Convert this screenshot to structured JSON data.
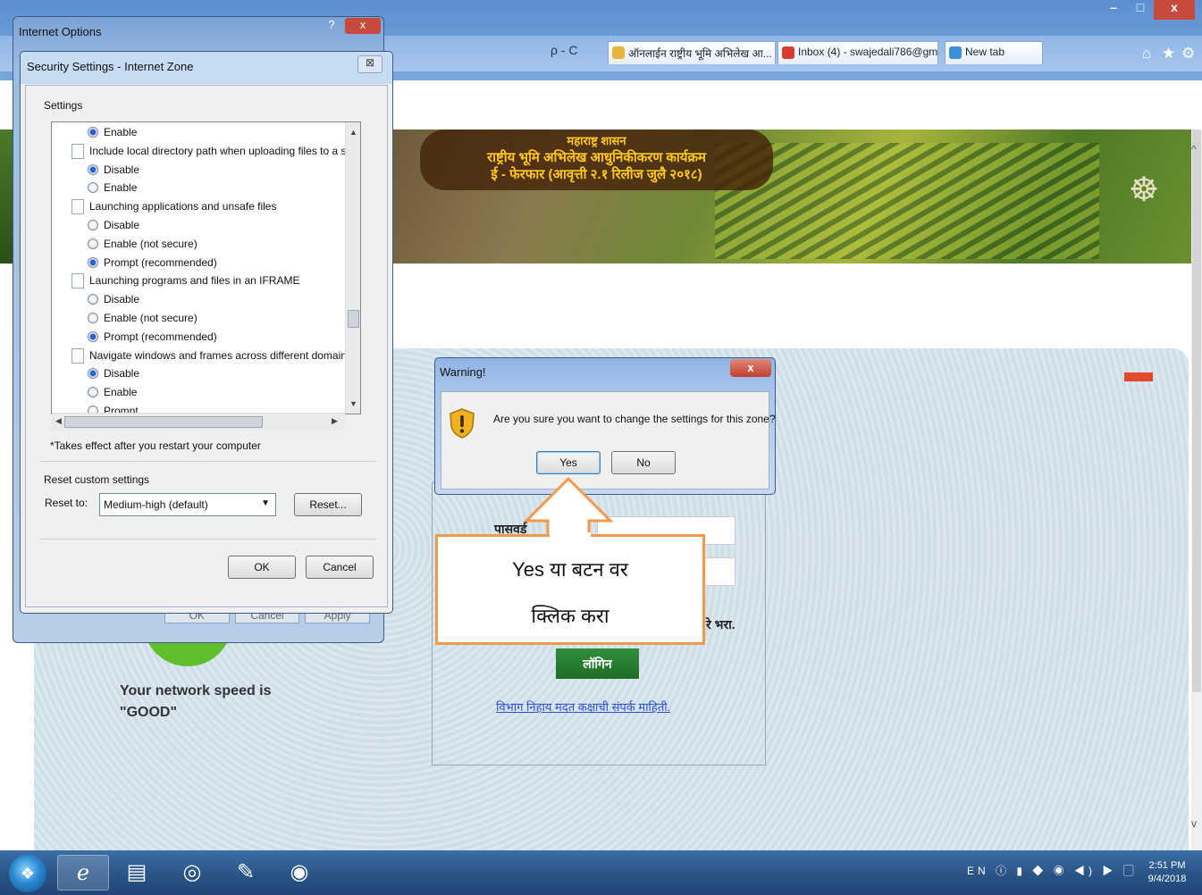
{
  "browser": {
    "tabs": [
      {
        "label": "ऑनलाईन राष्ट्रीय भूमि अभिलेख आ... ×",
        "color": "#e8b53c"
      },
      {
        "label": "Inbox (4) - swajedali786@gm...",
        "color": "#d93b30"
      },
      {
        "label": "New tab",
        "color": "#3a8fd8"
      }
    ],
    "address_tools": "ρ - C",
    "toolbar_icons": [
      "home-icon",
      "star-icon",
      "gear-icon"
    ],
    "window_controls": [
      "–",
      "□",
      "x"
    ]
  },
  "banner": {
    "line1": "महाराष्ट्र शासन",
    "line2": "राष्ट्रीय भूमि अभिलेख आधुनिकीकरण कार्यक्रम",
    "line3": "ई - फेरफार (आवृत्ती २.१ रिलीज जुलै २०१८)",
    "emblem": "seal-emblem"
  },
  "page": {
    "password_label": "पासवर्ड",
    "tail_text": "रे भरा.",
    "login_button": "लॉगिन",
    "help_link": "विभाग निहाय मदत कक्षाची संपर्क माहिती.",
    "network_speed_line1": "Your network speed is",
    "network_speed_line2": "\"GOOD\""
  },
  "internet_options": {
    "title": "Internet Options",
    "help": "?",
    "close": "x",
    "buttons": [
      "OK",
      "Cancel",
      "Apply"
    ]
  },
  "security_settings": {
    "title": "Security Settings - Internet Zone",
    "close": "⊠",
    "settings_label": "Settings",
    "items": [
      {
        "type": "opt",
        "label": "Enable",
        "checked": true
      },
      {
        "type": "hdr",
        "label": "Include local directory path when uploading files to a server"
      },
      {
        "type": "opt",
        "label": "Disable",
        "checked": true
      },
      {
        "type": "opt",
        "label": "Enable",
        "checked": false
      },
      {
        "type": "hdr",
        "label": "Launching applications and unsafe files"
      },
      {
        "type": "opt",
        "label": "Disable",
        "checked": false
      },
      {
        "type": "opt",
        "label": "Enable (not secure)",
        "checked": false
      },
      {
        "type": "opt",
        "label": "Prompt (recommended)",
        "checked": true
      },
      {
        "type": "hdr",
        "label": "Launching programs and files in an IFRAME"
      },
      {
        "type": "opt",
        "label": "Disable",
        "checked": false
      },
      {
        "type": "opt",
        "label": "Enable (not secure)",
        "checked": false
      },
      {
        "type": "opt",
        "label": "Prompt (recommended)",
        "checked": true
      },
      {
        "type": "hdr",
        "label": "Navigate windows and frames across different domains"
      },
      {
        "type": "opt",
        "label": "Disable",
        "checked": true
      },
      {
        "type": "opt",
        "label": "Enable",
        "checked": false
      },
      {
        "type": "opt",
        "label": "Prompt",
        "checked": false
      }
    ],
    "takes_effect_note": "*Takes effect after you restart your computer",
    "reset_custom_label": "Reset custom settings",
    "reset_to_label": "Reset to:",
    "reset_to_value": "Medium-high (default)",
    "reset_button": "Reset...",
    "ok_button": "OK",
    "cancel_button": "Cancel"
  },
  "warning": {
    "title": "Warning!",
    "close": "x",
    "message": "Are you sure you want to change the settings for this zone?",
    "yes": "Yes",
    "no": "No"
  },
  "callout": {
    "line1": "Yes या बटन वर",
    "line2": "क्लिक करा",
    "color": "#f29a4a"
  },
  "taskbar": {
    "items": [
      "ie-icon",
      "folder-icon",
      "chrome-icon",
      "paint-icon",
      "firefox-icon"
    ],
    "tray": "EN ⓘ ▮ ◆ ◉ ◀) ▶ ▢",
    "time": "2:51 PM",
    "date": "9/4/2018"
  }
}
